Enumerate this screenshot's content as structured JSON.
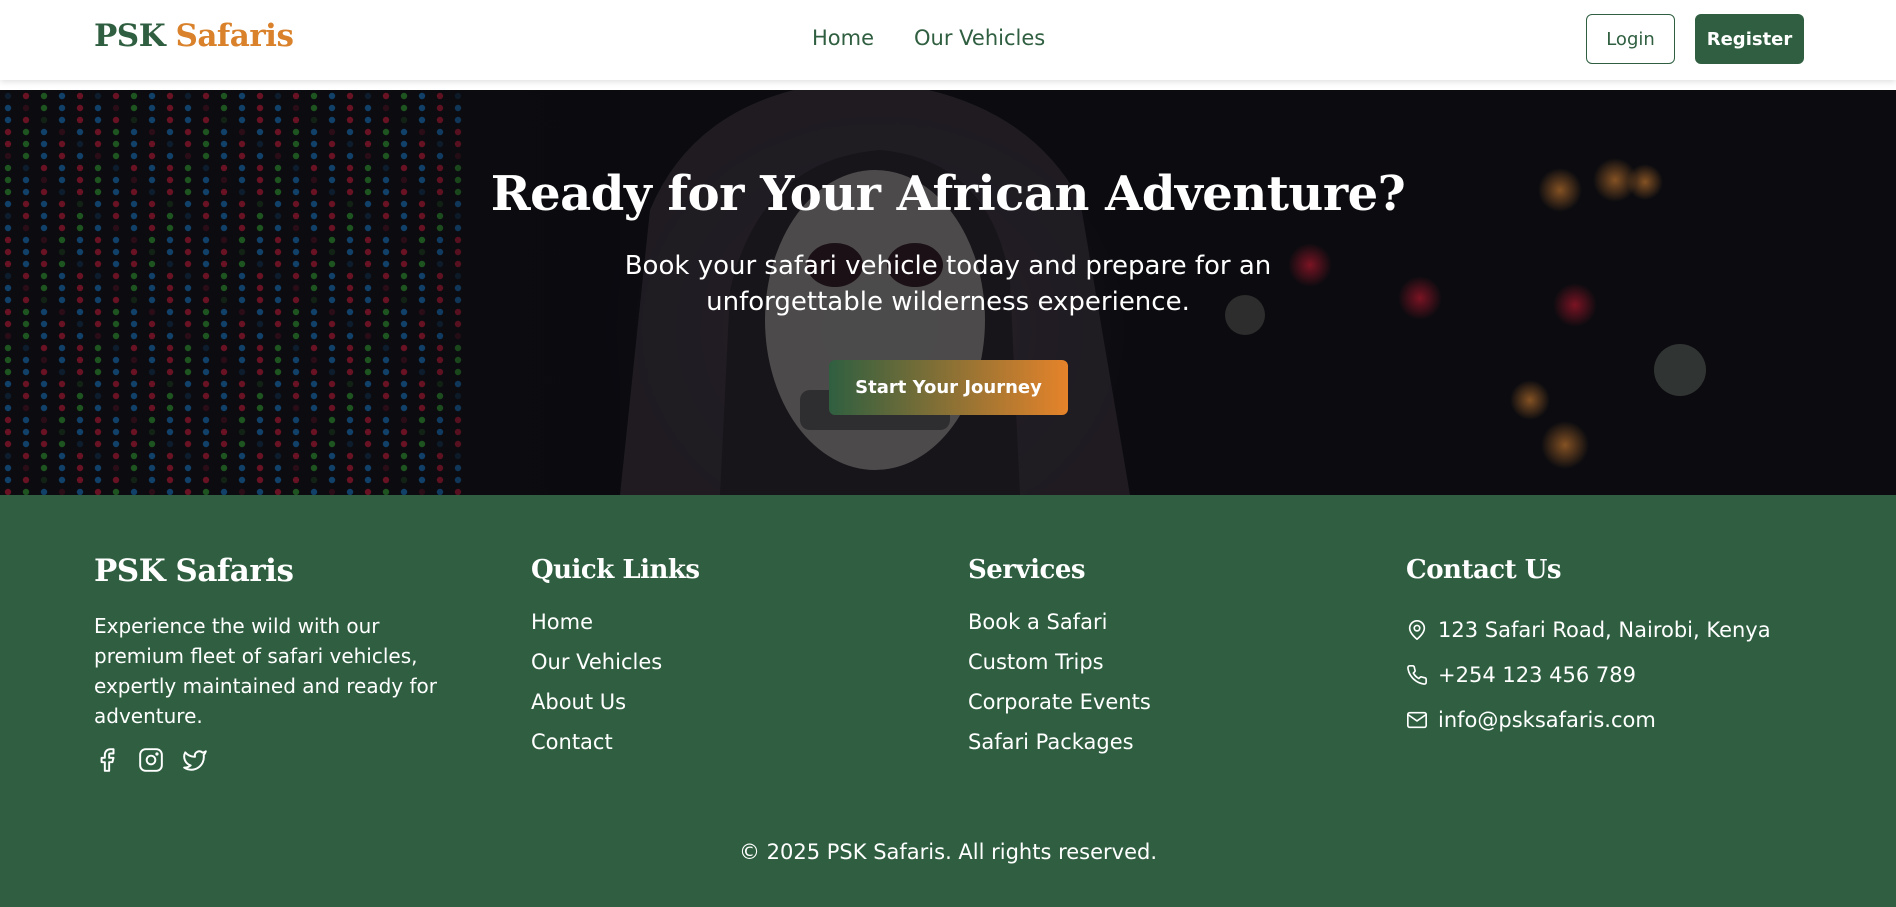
{
  "header": {
    "logo_part1": "PSK",
    "logo_part2": "Safaris",
    "nav": {
      "home": "Home",
      "vehicles": "Our Vehicles"
    },
    "login_label": "Login",
    "register_label": "Register"
  },
  "hero": {
    "title": "Ready for Your African Adventure?",
    "subtitle": "Book your safari vehicle today and prepare for an unforgettable wilderness experience.",
    "cta_label": "Start Your Journey"
  },
  "footer": {
    "brand": "PSK Safaris",
    "description": "Experience the wild with our premium fleet of safari vehicles, expertly maintained and ready for adventure.",
    "socials": [
      "facebook-icon",
      "instagram-icon",
      "twitter-icon"
    ],
    "quick_links": {
      "heading": "Quick Links",
      "items": [
        "Home",
        "Our Vehicles",
        "About Us",
        "Contact"
      ]
    },
    "services": {
      "heading": "Services",
      "items": [
        "Book a Safari",
        "Custom Trips",
        "Corporate Events",
        "Safari Packages"
      ]
    },
    "contact": {
      "heading": "Contact Us",
      "address": "123 Safari Road, Nairobi, Kenya",
      "phone": "+254 123 456 789",
      "email": "info@psksafaris.com"
    },
    "copyright": "© 2025 PSK Safaris. All rights reserved."
  },
  "colors": {
    "brand_green": "#2f5f40",
    "brand_orange": "#d9822b",
    "footer_bg": "#2f5f40"
  }
}
